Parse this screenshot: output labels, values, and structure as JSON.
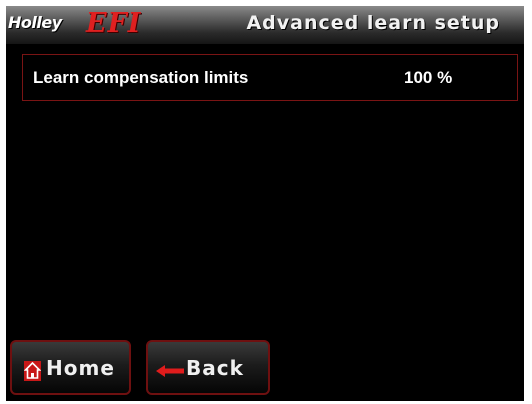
{
  "header": {
    "logo_holley": "Holley",
    "logo_efi": "EFI",
    "title": "Advanced learn setup"
  },
  "settings": [
    {
      "label": "Learn compensation limits",
      "value": "100 %"
    }
  ],
  "buttons": {
    "home_label": "Home",
    "home_icon": "home-icon",
    "back_label": "Back",
    "back_icon": "left-arrow-icon"
  },
  "colors": {
    "background": "#000000",
    "accent": "#d81e1e",
    "border": "#7a1414",
    "text": "#ffffff"
  }
}
